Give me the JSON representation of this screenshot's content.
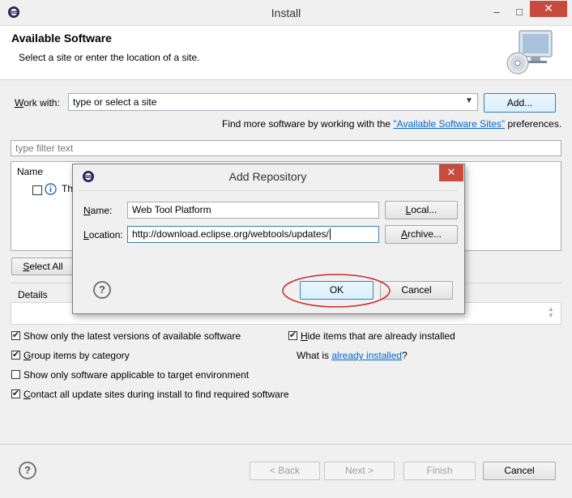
{
  "window": {
    "title": "Install",
    "minimize": "–",
    "maximize": "□",
    "close": "✕"
  },
  "header": {
    "title": "Available Software",
    "subtitle": "Select a site or enter the location of a site."
  },
  "work_with": {
    "label_u": "W",
    "label_rest": "ork with:",
    "value": "type or select a site",
    "add_button": "Add...",
    "find_more_prefix": "Find more software by working with the ",
    "find_more_link": "\"Available Software Sites\"",
    "find_more_suffix": " preferences."
  },
  "filter": {
    "placeholder": "type filter text"
  },
  "table": {
    "column_name": "Name",
    "row_text": "Th"
  },
  "select_all": {
    "u": "S",
    "rest": "elect All"
  },
  "details": {
    "label": "Details"
  },
  "options": {
    "latest": "Show only the latest versions of available software",
    "group_u": "G",
    "group_rest": "roup items by category",
    "target": "Show only software applicable to target environment",
    "contact_u": "C",
    "contact_rest": "ontact all update sites during install to find required software",
    "hide_u": "H",
    "hide_rest": "ide items that are already installed",
    "what_is": "What is ",
    "already_installed": "already installed",
    "what_is_suffix": "?"
  },
  "footer": {
    "back": "< Back",
    "next": "Next >",
    "finish": "Finish",
    "cancel": "Cancel"
  },
  "dialog": {
    "title": "Add Repository",
    "name_label_u": "N",
    "name_label_rest": "ame:",
    "name_value": "Web Tool Platform",
    "local_u": "L",
    "local_rest": "ocal...",
    "location_label_u": "L",
    "location_label_rest": "ocation:",
    "location_value": "http://download.eclipse.org/webtools/updates/",
    "archive_u": "A",
    "archive_rest": "rchive...",
    "ok": "OK",
    "cancel": "Cancel"
  },
  "colors": {
    "close_red": "#c74a3c",
    "link_blue": "#0066cc",
    "highlight_ellipse": "#cc2a2a"
  },
  "icons": [
    "eclipse-icon",
    "cd-monitor-icon",
    "info-icon",
    "help-icon",
    "dropdown-arrow-icon"
  ]
}
